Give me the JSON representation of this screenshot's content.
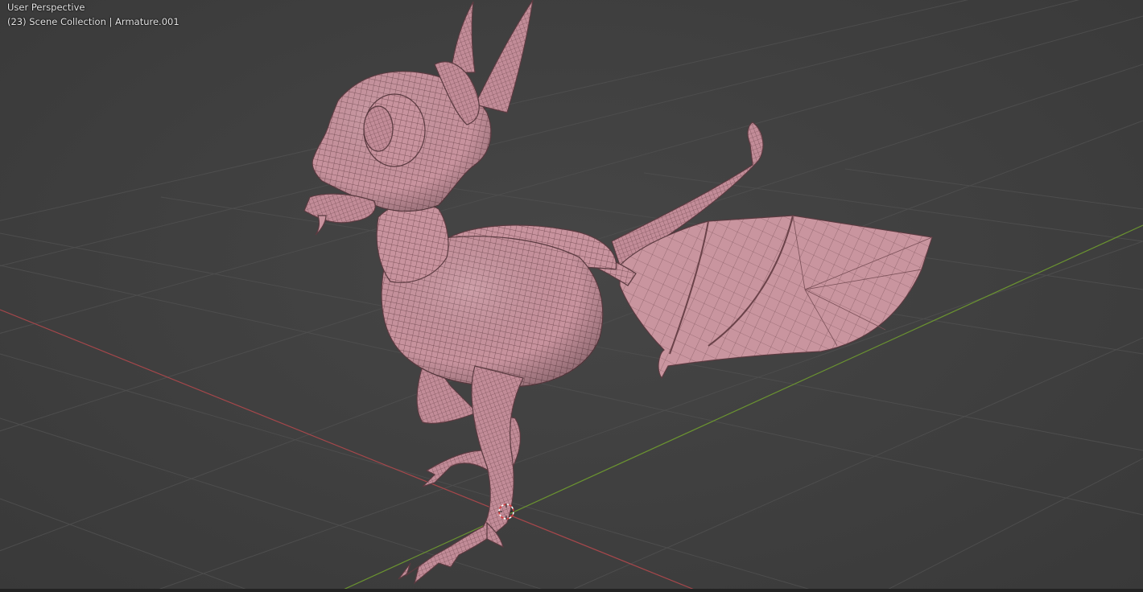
{
  "viewport": {
    "view_name": "User Perspective",
    "frame_number": "(23)",
    "collection_and_object": "Scene Collection | Armature.001",
    "status_line": "(23) Scene Collection | Armature.001"
  },
  "scene": {
    "object": "dragon-mesh",
    "shading": "solid-with-wireframe",
    "mesh_color": "#c8939e",
    "wire_color": "#5a3a40",
    "grid_color": "#4f4f4f",
    "x_axis_color": "#b24a4e",
    "y_axis_color": "#6f9a2e",
    "background_color": "#3d3d3d",
    "cursor_icon": "3d-cursor-icon"
  }
}
